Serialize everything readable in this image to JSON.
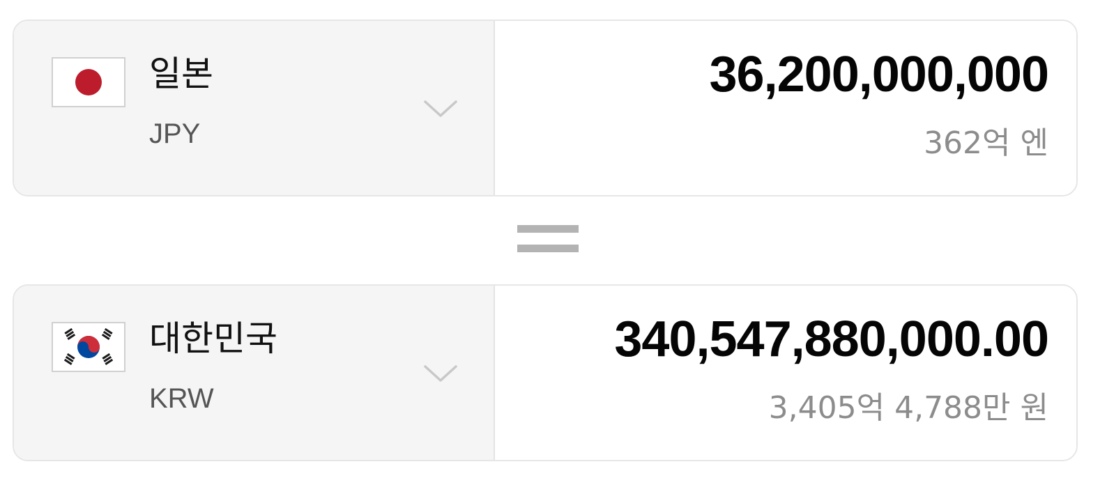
{
  "source": {
    "country": "일본",
    "currency_code": "JPY",
    "amount": "36,200,000,000",
    "amount_in_words": "362억 엔",
    "flag_icon": "japan-flag-icon"
  },
  "target": {
    "country": "대한민국",
    "currency_code": "KRW",
    "amount": "340,547,880,000.00",
    "amount_in_words": "3,405억 4,788만 원",
    "flag_icon": "korea-flag-icon"
  },
  "equals_icon": "equals-icon",
  "dropdown_icon": "chevron-down-icon",
  "colors": {
    "card_border": "#e6e6e6",
    "selector_bg": "#f5f5f5",
    "amount_text": "#050505",
    "secondary_text": "#8c8c8c",
    "japan_red": "#bc1c2c",
    "korea_red": "#cd2e3a",
    "korea_blue": "#0047a0"
  }
}
